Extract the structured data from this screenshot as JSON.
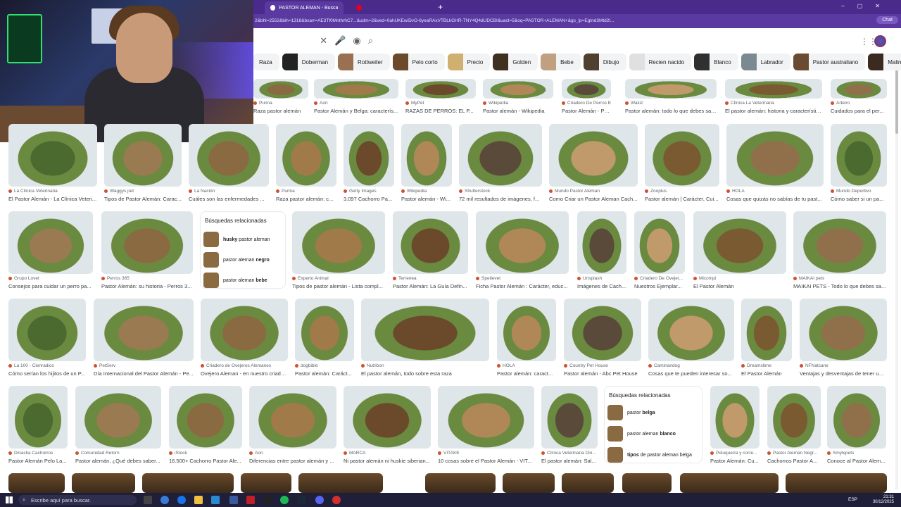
{
  "browser": {
    "tab_title": "PASTOR ALEMAN - Buscar con Go...",
    "second_tab": "",
    "url": "2&bhl=2552&bih=1316&bsarr=AE3Tf0MnthrhC7...&udm=2&ved=0ahUKEwiDvO-6yeaRAxVTBLkGHR-TNY4Q4dUDCBI&uact=5&oq=PASTOR+ALEMAN+&gs_lp=Egtnd3Mtd2l...",
    "chat_label": "Chat"
  },
  "chips": [
    {
      "label": "Raza",
      "thumb": false
    },
    {
      "label": "Doberman",
      "thumb": true
    },
    {
      "label": "Rottweiler",
      "thumb": true
    },
    {
      "label": "Pelo corto",
      "thumb": true
    },
    {
      "label": "Precio",
      "thumb": true
    },
    {
      "label": "Golden",
      "thumb": true
    },
    {
      "label": "Bebe",
      "thumb": true
    },
    {
      "label": "Dibujo",
      "thumb": true
    },
    {
      "label": "Recien nacido",
      "thumb": true
    },
    {
      "label": "Blanco",
      "thumb": true
    },
    {
      "label": "Labrador",
      "thumb": true
    },
    {
      "label": "Pastor australiano",
      "thumb": true
    },
    {
      "label": "Malinois",
      "thumb": true
    }
  ],
  "related_1": {
    "title": "Búsquedas relacionadas",
    "items": [
      {
        "pre": "",
        "bold": "husky",
        "post": " pastor aleman"
      },
      {
        "pre": "pastor aleman ",
        "bold": "negro",
        "post": ""
      },
      {
        "pre": "pastor aleman ",
        "bold": "bebe",
        "post": ""
      }
    ]
  },
  "related_2": {
    "title": "Búsquedas relacionadas",
    "items": [
      {
        "pre": "pastor ",
        "bold": "belga",
        "post": ""
      },
      {
        "pre": "pastor aleman ",
        "bold": "blanco",
        "post": ""
      },
      {
        "pre": "",
        "bold": "tipos",
        "post": " de pastor aleman belga"
      }
    ]
  },
  "results": [
    {
      "src": "Purina",
      "cap": "Raza pastor alemán"
    },
    {
      "src": "Aon",
      "cap": "Pastor Alemán y Belga: caracterís..."
    },
    {
      "src": "MyPet",
      "cap": "RAZAS DE PERROS: EL P..."
    },
    {
      "src": "Wikipedia",
      "cap": "Pastor alemán - Wikipedia"
    },
    {
      "src": "Criadero De Perros E...",
      "cap": "Pastor Alemán - Perr..."
    },
    {
      "src": "Wakiz",
      "cap": "Pastor alemán: todo lo que debes sab..."
    },
    {
      "src": "Clínica La Veterinaria",
      "cap": "El pastor alemán: historia y característic..."
    },
    {
      "src": "Arteiro",
      "cap": "Cuidados para el per..."
    },
    {
      "src": "La Clínica Veterinaria",
      "cap": "El Pastor Alemán - La Clínica Veteri..."
    },
    {
      "src": "Waggys pet",
      "cap": "Tipos de Pastor Alemán: Carac..."
    },
    {
      "src": "La Nación",
      "cap": "Cuáles son las enfermedades ..."
    },
    {
      "src": "Purina",
      "cap": "Raza pastor alemán: c..."
    },
    {
      "src": "Getty Images",
      "cap": "3.097 Cachorro Pa..."
    },
    {
      "src": "Wikipedia",
      "cap": "Pastor alemán - Wi..."
    },
    {
      "src": "Shutterstock",
      "cap": "72 mil resultados de imágenes, f..."
    },
    {
      "src": "Mundo Pastor Aleman",
      "cap": "Como Criar un Pastor Aleman Cach..."
    },
    {
      "src": "Zooplus",
      "cap": "Pastor alemán | Carácter, Cui..."
    },
    {
      "src": "HOLA",
      "cap": "Cosas que quizás no sabías de tu past..."
    },
    {
      "src": "Mundo Deportivo",
      "cap": "Cómo saber si un pa..."
    },
    {
      "src": "Grupo Lovet",
      "cap": "Consejos para cuidar un perro pa..."
    },
    {
      "src": "Perros 365",
      "cap": "Pastor Alemán: su historia - Perros 3..."
    },
    {
      "src": "Experto Animal",
      "cap": "Tipos de pastor alemán - Lista compl..."
    },
    {
      "src": "Terrenea",
      "cap": "Pastor Alemán: La Guía Defin..."
    },
    {
      "src": "Spetlevet",
      "cap": "Ficha Pastor Alemán : Carácter, educ..."
    },
    {
      "src": "Unsplash",
      "cap": "Imágenes de Cach..."
    },
    {
      "src": "Criadero De Ovejer...",
      "cap": "Nuestros Ejemplar..."
    },
    {
      "src": "Micompi",
      "cap": "El Pastor Alemán"
    },
    {
      "src": "MAIKAI pets",
      "cap": "MAIKAI PETS - Todo lo que debes sa..."
    },
    {
      "src": "La 100 - Cienradios",
      "cap": "Cómo serían los hijitos de un P..."
    },
    {
      "src": "PetServ",
      "cap": "Día Internacional del Pastor Alemán - Pe..."
    },
    {
      "src": "Criadero de Ovejeros Alemanes",
      "cap": "Ovejero Aleman - en nuestro criade..."
    },
    {
      "src": "dogbible",
      "cap": "Pastor alemán: Caráct..."
    },
    {
      "src": "Nutribon",
      "cap": "El pastor alemán, todo sobre esta raza"
    },
    {
      "src": "HOLA",
      "cap": "Pastor alemán: caract..."
    },
    {
      "src": "Country Pet House",
      "cap": "Pastor alemán - Abc Pet House"
    },
    {
      "src": "Caminandog",
      "cap": "Cosas que te pueden interesar so..."
    },
    {
      "src": "Dreamstime",
      "cap": "El Pastor Alemán"
    },
    {
      "src": "NFNatcane",
      "cap": "Ventajas y desventajas de tener un ..."
    },
    {
      "src": "Dinastia Cachorros",
      "cap": "Pastor Alemán Pelo La..."
    },
    {
      "src": "Comunidad Retorn",
      "cap": "Pastor alemán, ¿Qué debes saber..."
    },
    {
      "src": "iStock",
      "cap": "16.500+ Cachorro Pastor Ale..."
    },
    {
      "src": "Aon",
      "cap": "Diferencias entre pastor alemán y ..."
    },
    {
      "src": "MARCA",
      "cap": "Ni pastor alemán ni huskie siberian..."
    },
    {
      "src": "VITAKE",
      "cap": "10 cosas sobre el Pastor Alemán - VIT..."
    },
    {
      "src": "Clínica Veterinaria Din...",
      "cap": "El pastor alemán: Sal..."
    },
    {
      "src": "Peluquería y corre...",
      "cap": "Pastor Alemán: Cu..."
    },
    {
      "src": "Pastor Aleman Negr...",
      "cap": "Cachorros Pastor A..."
    },
    {
      "src": "Smylepets",
      "cap": "Conoce al Pastor Alem..."
    }
  ],
  "taskbar": {
    "search_placeholder": "Escribe aquí para buscar.",
    "lang": "ESP",
    "time": "21:31",
    "date": "30/12/2025"
  }
}
